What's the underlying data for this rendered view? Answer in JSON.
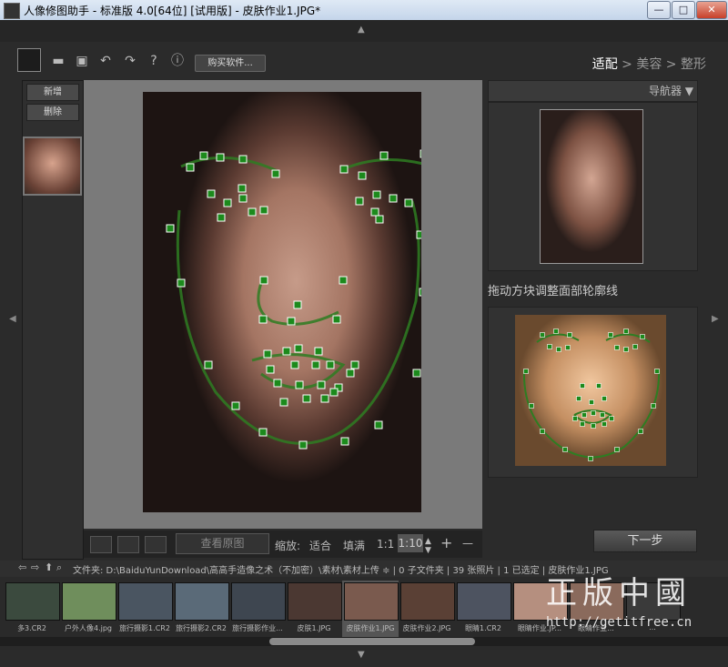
{
  "window": {
    "title": "人像修图助手 - 标准版 4.0[64位] [试用版] - 皮肤作业1.JPG*",
    "controls": {
      "minimize": "—",
      "maximize": "□",
      "close": "✕"
    }
  },
  "toolbar": {
    "buy_label": "购买软件...",
    "icons": [
      "logo-icon",
      "folder-icon",
      "save-icon",
      "undo-icon",
      "redo-icon",
      "help-icon",
      "info-icon"
    ],
    "glyphs": {
      "folder": "▬",
      "save": "▣",
      "undo": "↶",
      "redo": "↷",
      "help": "?",
      "info": "ⓘ"
    }
  },
  "workflow": {
    "step1": "适配",
    "sep1": " > ",
    "step2": "美容",
    "sep2": " > ",
    "step3": "整形",
    "active": "适配"
  },
  "left_panel": {
    "add_label": "新增",
    "delete_label": "删除"
  },
  "bottom_bar": {
    "view_original_label": "查看原图",
    "zoom_label": "缩放:",
    "fit_label": "适合",
    "fill_label": "填满",
    "ratio_label": "1:1",
    "zoom_value": "1:10",
    "plus": "+",
    "minus": "—"
  },
  "navigator": {
    "label": "导航器 ▼"
  },
  "hint": {
    "text": "拖动方块调整面部轮廓线"
  },
  "next_button": {
    "label": "下一步"
  },
  "pathbar": {
    "text": "文件夹: D:\\BaiduYunDownload\\高高手造像之术（不加密）\\素材\\素材上传 ≑ | 0 子文件夹 | 39 张照片 | 1 已选定 | 皮肤作业1.JPG"
  },
  "filmstrip": [
    {
      "caption": "多3.CR2",
      "color": "#3b4a3e"
    },
    {
      "caption": "户外人像4.jpg",
      "color": "#6f8e5c"
    },
    {
      "caption": "旅行摄影1.CR2",
      "color": "#4a5561"
    },
    {
      "caption": "旅行摄影2.CR2",
      "color": "#5a6a78"
    },
    {
      "caption": "旅行摄影作业...",
      "color": "#3e4650"
    },
    {
      "caption": "皮肤1.JPG",
      "color": "#4b3832"
    },
    {
      "caption": "皮肤作业1.JPG",
      "color": "#7a5a4e",
      "selected": true
    },
    {
      "caption": "皮肤作业2.JPG",
      "color": "#5a4035"
    },
    {
      "caption": "眼睛1.CR2",
      "color": "#4d5360"
    },
    {
      "caption": "眼睛作业.JP...",
      "color": "#b58f7f"
    },
    {
      "caption": "眼睛作业...",
      "color": "#8a6a5c"
    },
    {
      "caption": "...",
      "color": "#3a3a3a"
    }
  ],
  "watermark": {
    "chinese": "正版中國",
    "url": "http://getitfree.cn"
  },
  "colors": {
    "landmark": "#1c8a1c",
    "contour": "#2e7d22",
    "accent_white": "#ffffff"
  }
}
